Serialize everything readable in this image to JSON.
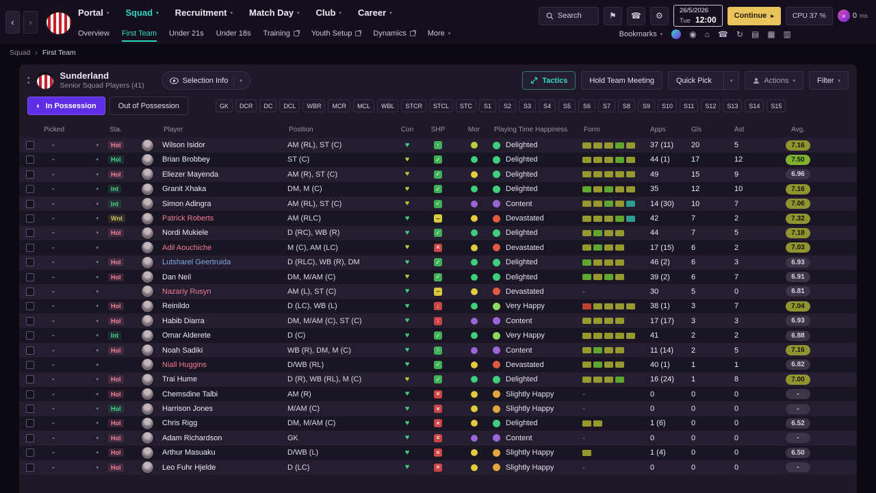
{
  "colors": {
    "teal": "#33d6c5",
    "purple": "#5e2ee6",
    "gold": "#e9c35c",
    "pink": "#ef7b93",
    "green": "#3ecf7d",
    "lightgreen": "#8fd95f",
    "yellowgreen": "#b7cf3a",
    "yellow": "#e2cb3d",
    "orange": "#e2a43c",
    "red": "#d9503f",
    "olive": "#95992e",
    "blue": "#7fa8e0"
  },
  "icons": {
    "caret_down": "▾",
    "back": "‹",
    "forward": "›",
    "play": "▸",
    "fast_forward": "»",
    "collapse_up": "▴",
    "collapse_down": "▾",
    "possession": "◐",
    "heart": "♥",
    "breadcrumb_sep": "›",
    "shp_glyphs": {
      "check": "✓",
      "up": "↑",
      "dash": "–",
      "cross": "×",
      "down": "↓"
    }
  },
  "topbar": {
    "nav": [
      {
        "label": "Portal",
        "active": false
      },
      {
        "label": "Squad",
        "active": true
      },
      {
        "label": "Recruitment",
        "active": false
      },
      {
        "label": "Match Day",
        "active": false
      },
      {
        "label": "Club",
        "active": false
      },
      {
        "label": "Career",
        "active": false
      }
    ],
    "search_label": "Search",
    "icon_buttons": [
      {
        "name": "banner-icon",
        "glyph": "⚑"
      },
      {
        "name": "device-icon",
        "glyph": "☎"
      },
      {
        "name": "settings-gear-icon",
        "glyph": "⚙"
      }
    ],
    "date_line1": "26/5/2026",
    "date_day": "Tue",
    "date_time": "12:00",
    "continue_label": "Continue",
    "cpu_label": "CPU 37 %",
    "timer_value": "0",
    "timer_unit": "ms"
  },
  "subnav": {
    "items": [
      {
        "label": "Overview",
        "active": false,
        "external": false,
        "dropdown": false
      },
      {
        "label": "First Team",
        "active": true,
        "external": false,
        "dropdown": false
      },
      {
        "label": "Under 21s",
        "active": false,
        "external": false,
        "dropdown": false
      },
      {
        "label": "Under 18s",
        "active": false,
        "external": false,
        "dropdown": false
      },
      {
        "label": "Training",
        "active": false,
        "external": true,
        "dropdown": false
      },
      {
        "label": "Youth Setup",
        "active": false,
        "external": true,
        "dropdown": false
      },
      {
        "label": "Dynamics",
        "active": false,
        "external": true,
        "dropdown": false
      },
      {
        "label": "More",
        "active": false,
        "external": false,
        "dropdown": true
      }
    ],
    "bookmarks_label": "Bookmarks",
    "toolbar_icons": [
      {
        "name": "manager-profile-badge",
        "glyph": ""
      },
      {
        "name": "medal-icon",
        "glyph": "◉"
      },
      {
        "name": "stadium-icon",
        "glyph": "⌂"
      },
      {
        "name": "phone-icon",
        "glyph": "☎"
      },
      {
        "name": "refresh-icon",
        "glyph": "↻"
      },
      {
        "name": "notes-icon",
        "glyph": "▤"
      },
      {
        "name": "calendar-icon",
        "glyph": "▦"
      },
      {
        "name": "apps-grid-icon",
        "glyph": "▥"
      }
    ]
  },
  "breadcrumb": {
    "items": [
      "Squad",
      "First Team"
    ]
  },
  "panel_header": {
    "club_name": "Sunderland",
    "subtitle": "Senior Squad Players (41)",
    "selection_info_label": "Selection Info",
    "tactics_label": "Tactics",
    "hold_meeting_label": "Hold Team Meeting",
    "quick_pick_label": "Quick Pick",
    "actions_label": "Actions",
    "filter_label": "Filter"
  },
  "possession": {
    "in_label": "In Possession",
    "out_label": "Out of Possession"
  },
  "position_filters": [
    "GK",
    "DCR",
    "DC",
    "DCL",
    "WBR",
    "MCR",
    "MCL",
    "WBL",
    "STCR",
    "STCL",
    "STC",
    "S1",
    "S2",
    "S3",
    "S4",
    "S5",
    "S6",
    "S7",
    "S8",
    "S9",
    "S10",
    "S11",
    "S12",
    "S13",
    "S14",
    "S15"
  ],
  "table": {
    "columns": [
      "Picked",
      "Sta.",
      "Player",
      "Position",
      "Con",
      "SHP",
      "Mor",
      "Playing Time Happiness",
      "Form",
      "Apps",
      "Gls",
      "Ast",
      "Avg."
    ],
    "rows": [
      {
        "picked": "-",
        "sta": "Hol",
        "sta_color": "pink",
        "name": "Wilson Isidor",
        "name_color": "default",
        "position": "AM (RL), ST (C)",
        "con": "green",
        "shp": "up",
        "mor": "yellowgreen",
        "happiness": "Delighted",
        "happiness_color": "green",
        "form": [
          "olive",
          "olive",
          "olive",
          "green",
          "olive"
        ],
        "apps": "37 (11)",
        "gls": "20",
        "ast": "5",
        "avg": "7.16",
        "avg_color": "olive"
      },
      {
        "picked": "-",
        "sta": "Hol",
        "sta_color": "green",
        "name": "Brian Brobbey",
        "name_color": "default",
        "position": "ST (C)",
        "con": "yellow",
        "shp": "check",
        "mor": "green",
        "happiness": "Delighted",
        "happiness_color": "green",
        "form": [
          "olive",
          "olive",
          "olive",
          "green",
          "olive"
        ],
        "apps": "44 (1)",
        "gls": "17",
        "ast": "12",
        "avg": "7.50",
        "avg_color": "green"
      },
      {
        "picked": "-",
        "sta": "Hol",
        "sta_color": "pink",
        "name": "Eliezer Mayenda",
        "name_color": "default",
        "position": "AM (R), ST (C)",
        "con": "yellow",
        "shp": "check",
        "mor": "yellow",
        "happiness": "Delighted",
        "happiness_color": "green",
        "form": [
          "olive",
          "olive",
          "olive",
          "olive",
          "olive"
        ],
        "apps": "49",
        "gls": "15",
        "ast": "9",
        "avg": "6.96",
        "avg_color": "gray"
      },
      {
        "picked": "-",
        "sta": "Int",
        "sta_color": "green",
        "name": "Granit Xhaka",
        "name_color": "default",
        "position": "DM, M (C)",
        "con": "yellow",
        "shp": "check",
        "mor": "green",
        "happiness": "Delighted",
        "happiness_color": "green",
        "form": [
          "green",
          "olive",
          "green",
          "olive",
          "olive"
        ],
        "apps": "35",
        "gls": "12",
        "ast": "10",
        "avg": "7.16",
        "avg_color": "olive"
      },
      {
        "picked": "-",
        "sta": "Int",
        "sta_color": "green",
        "name": "Simon Adingra",
        "name_color": "default",
        "position": "AM (RL), ST (C)",
        "con": "yellow",
        "shp": "check",
        "mor": "purple",
        "happiness": "Content",
        "happiness_color": "purple",
        "form": [
          "olive",
          "olive",
          "green",
          "olive",
          "teal"
        ],
        "apps": "14 (30)",
        "gls": "10",
        "ast": "7",
        "avg": "7.06",
        "avg_color": "olive"
      },
      {
        "picked": "-",
        "sta": "Wnt",
        "sta_color": "olive",
        "name": "Patrick Roberts",
        "name_color": "pink",
        "position": "AM (RLC)",
        "con": "green",
        "shp": "dash",
        "mor": "yellow",
        "happiness": "Devastated",
        "happiness_color": "red",
        "form": [
          "olive",
          "olive",
          "olive",
          "green",
          "teal"
        ],
        "apps": "42",
        "gls": "7",
        "ast": "2",
        "avg": "7.32",
        "avg_color": "olive"
      },
      {
        "picked": "-",
        "sta": "Hol",
        "sta_color": "pink",
        "name": "Nordi Mukiele",
        "name_color": "default",
        "position": "D (RC), WB (R)",
        "con": "green",
        "shp": "check",
        "mor": "green",
        "happiness": "Delighted",
        "happiness_color": "green",
        "form": [
          "olive",
          "green",
          "olive",
          "olive"
        ],
        "apps": "44",
        "gls": "7",
        "ast": "5",
        "avg": "7.18",
        "avg_color": "olive"
      },
      {
        "picked": "-",
        "sta": "",
        "sta_color": "pink",
        "name": "Adil Aouchiche",
        "name_color": "pink",
        "position": "M (C), AM (LC)",
        "con": "yellow",
        "shp": "cross",
        "mor": "yellow",
        "happiness": "Devastated",
        "happiness_color": "red",
        "form": [
          "olive",
          "green",
          "olive",
          "olive"
        ],
        "apps": "17 (15)",
        "gls": "6",
        "ast": "2",
        "avg": "7.03",
        "avg_color": "olive"
      },
      {
        "picked": "-",
        "sta": "Hol",
        "sta_color": "pink",
        "name": "Lutsharel Geertruida",
        "name_color": "blue",
        "position": "D (RLC), WB (R), DM",
        "con": "green",
        "shp": "check",
        "mor": "green",
        "happiness": "Delighted",
        "happiness_color": "green",
        "form": [
          "green",
          "olive",
          "olive",
          "olive"
        ],
        "apps": "46 (2)",
        "gls": "6",
        "ast": "3",
        "avg": "6.93",
        "avg_color": "gray"
      },
      {
        "picked": "-",
        "sta": "Hol",
        "sta_color": "pink",
        "name": "Dan Neil",
        "name_color": "default",
        "position": "DM, M/AM (C)",
        "con": "yellow",
        "shp": "check",
        "mor": "green",
        "happiness": "Delighted",
        "happiness_color": "green",
        "form": [
          "green",
          "olive",
          "green",
          "olive"
        ],
        "apps": "39 (2)",
        "gls": "6",
        "ast": "7",
        "avg": "6.91",
        "avg_color": "gray"
      },
      {
        "picked": "-",
        "sta": "",
        "sta_color": "pink",
        "name": "Nazariy Rusyn",
        "name_color": "pink",
        "position": "AM (L), ST (C)",
        "con": "green",
        "shp": "dash",
        "mor": "yellow",
        "happiness": "Devastated",
        "happiness_color": "red",
        "form": null,
        "apps": "30",
        "gls": "5",
        "ast": "0",
        "avg": "6.81",
        "avg_color": "gray"
      },
      {
        "picked": "-",
        "sta": "Hol",
        "sta_color": "pink",
        "name": "Reinildo",
        "name_color": "default",
        "position": "D (LC), WB (L)",
        "con": "green",
        "shp": "down",
        "mor": "green",
        "happiness": "Very Happy",
        "happiness_color": "lightgreen",
        "form": [
          "red",
          "olive",
          "olive",
          "olive",
          "olive"
        ],
        "apps": "38 (1)",
        "gls": "3",
        "ast": "7",
        "avg": "7.04",
        "avg_color": "olive"
      },
      {
        "picked": "-",
        "sta": "Hol",
        "sta_color": "pink",
        "name": "Habib Diarra",
        "name_color": "default",
        "position": "DM, M/AM (C), ST (C)",
        "con": "green",
        "shp": "down",
        "mor": "purple",
        "happiness": "Content",
        "happiness_color": "purple",
        "form": [
          "olive",
          "olive",
          "olive",
          "olive"
        ],
        "apps": "17 (17)",
        "gls": "3",
        "ast": "3",
        "avg": "6.93",
        "avg_color": "gray"
      },
      {
        "picked": "-",
        "sta": "Int",
        "sta_color": "green",
        "name": "Omar Alderete",
        "name_color": "default",
        "position": "D (C)",
        "con": "green",
        "shp": "check",
        "mor": "green",
        "happiness": "Very Happy",
        "happiness_color": "lightgreen",
        "form": [
          "olive",
          "olive",
          "olive",
          "olive",
          "olive"
        ],
        "apps": "41",
        "gls": "2",
        "ast": "2",
        "avg": "6.88",
        "avg_color": "gray"
      },
      {
        "picked": "-",
        "sta": "Hol",
        "sta_color": "pink",
        "name": "Noah Sadiki",
        "name_color": "default",
        "position": "WB (R), DM, M (C)",
        "con": "green",
        "shp": "up",
        "mor": "purple",
        "happiness": "Content",
        "happiness_color": "purple",
        "form": [
          "olive",
          "green",
          "olive",
          "olive"
        ],
        "apps": "11 (14)",
        "gls": "2",
        "ast": "5",
        "avg": "7.16",
        "avg_color": "olive"
      },
      {
        "picked": "-",
        "sta": "",
        "sta_color": "pink",
        "name": "Niall Huggins",
        "name_color": "pink",
        "position": "D/WB (RL)",
        "con": "green",
        "shp": "check",
        "mor": "yellow",
        "happiness": "Devastated",
        "happiness_color": "red",
        "form": [
          "olive",
          "green",
          "olive",
          "olive"
        ],
        "apps": "40 (1)",
        "gls": "1",
        "ast": "1",
        "avg": "6.82",
        "avg_color": "gray"
      },
      {
        "picked": "-",
        "sta": "Hol",
        "sta_color": "pink",
        "name": "Trai Hume",
        "name_color": "default",
        "position": "D (R), WB (RL), M (C)",
        "con": "yellow",
        "shp": "check",
        "mor": "green",
        "happiness": "Delighted",
        "happiness_color": "green",
        "form": [
          "olive",
          "olive",
          "olive",
          "green"
        ],
        "apps": "16 (24)",
        "gls": "1",
        "ast": "8",
        "avg": "7.00",
        "avg_color": "olive"
      },
      {
        "picked": "-",
        "sta": "Hol",
        "sta_color": "pink",
        "name": "Chemsdine Talbi",
        "name_color": "default",
        "position": "AM (R)",
        "con": "green",
        "shp": "cross",
        "mor": "yellow",
        "happiness": "Slightly Happy",
        "happiness_color": "orange",
        "form": null,
        "apps": "0",
        "gls": "0",
        "ast": "0",
        "avg": "-",
        "avg_color": "gray"
      },
      {
        "picked": "-",
        "sta": "Hol",
        "sta_color": "green",
        "name": "Harrison Jones",
        "name_color": "default",
        "position": "M/AM (C)",
        "con": "green",
        "shp": "cross",
        "mor": "yellow",
        "happiness": "Slightly Happy",
        "happiness_color": "orange",
        "form": null,
        "apps": "0",
        "gls": "0",
        "ast": "0",
        "avg": "-",
        "avg_color": "gray"
      },
      {
        "picked": "-",
        "sta": "Hol",
        "sta_color": "pink",
        "name": "Chris Rigg",
        "name_color": "default",
        "position": "DM, M/AM (C)",
        "con": "green",
        "shp": "cross",
        "mor": "yellow",
        "happiness": "Delighted",
        "happiness_color": "green",
        "form": [
          "olive",
          "olive"
        ],
        "apps": "1 (6)",
        "gls": "0",
        "ast": "0",
        "avg": "6.52",
        "avg_color": "gray"
      },
      {
        "picked": "-",
        "sta": "Hol",
        "sta_color": "pink",
        "name": "Adam Richardson",
        "name_color": "default",
        "position": "GK",
        "con": "green",
        "shp": "cross",
        "mor": "purple",
        "happiness": "Content",
        "happiness_color": "purple",
        "form": null,
        "apps": "0",
        "gls": "0",
        "ast": "0",
        "avg": "-",
        "avg_color": "gray"
      },
      {
        "picked": "-",
        "sta": "Hol",
        "sta_color": "pink",
        "name": "Arthur Masuaku",
        "name_color": "default",
        "position": "D/WB (L)",
        "con": "green",
        "shp": "cross",
        "mor": "yellow",
        "happiness": "Slightly Happy",
        "happiness_color": "orange",
        "form": [
          "olive"
        ],
        "apps": "1 (4)",
        "gls": "0",
        "ast": "0",
        "avg": "6.50",
        "avg_color": "gray"
      },
      {
        "picked": "-",
        "sta": "Hol",
        "sta_color": "pink",
        "name": "Leo Fuhr Hjelde",
        "name_color": "default",
        "position": "D (LC)",
        "con": "green",
        "shp": "cross",
        "mor": "yellow",
        "happiness": "Slightly Happy",
        "happiness_color": "orange",
        "form": null,
        "apps": "0",
        "gls": "0",
        "ast": "0",
        "avg": "-",
        "avg_color": "gray"
      }
    ]
  }
}
